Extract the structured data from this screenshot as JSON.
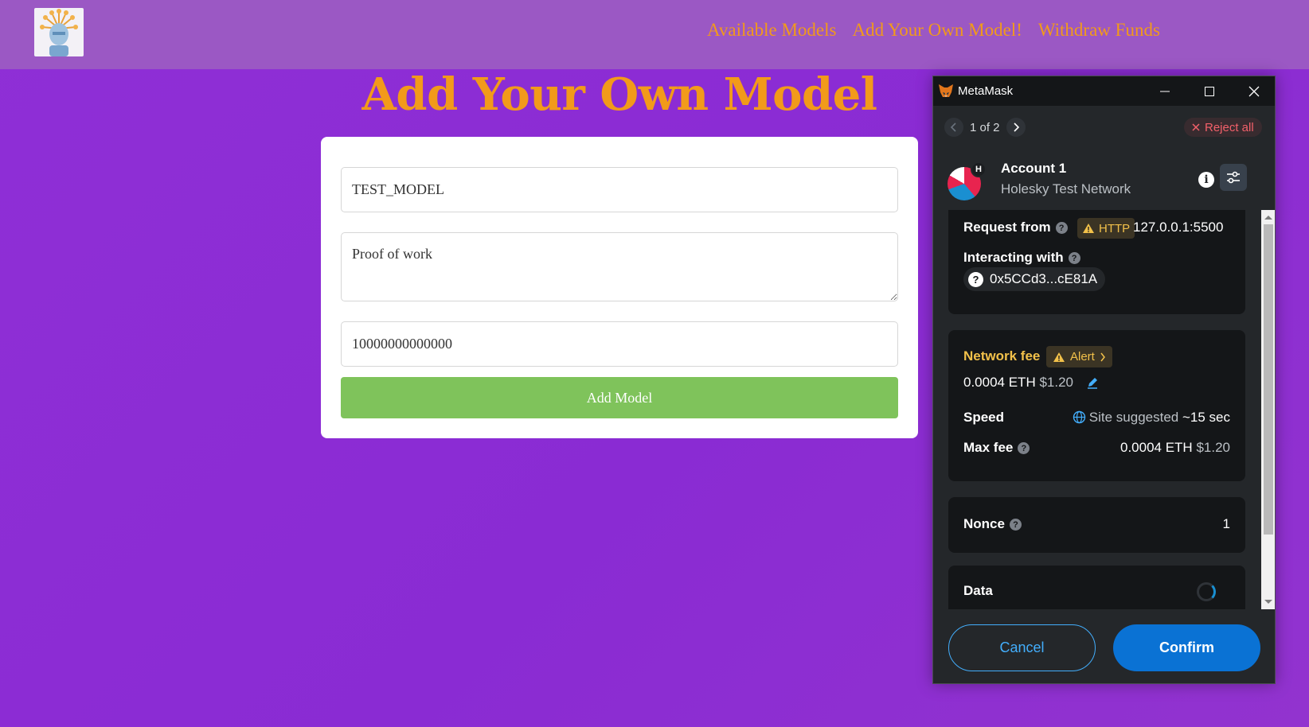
{
  "site": {
    "nav": {
      "available_models": "Available Models",
      "add_model": "Add Your Own Model!",
      "withdraw": "Withdraw Funds"
    },
    "page_title": "Add Your Own Model",
    "form": {
      "model_name": "TEST_MODEL",
      "description": "Proof of work",
      "price": "10000000000000",
      "submit_label": "Add Model"
    }
  },
  "metamask": {
    "window_title": "MetaMask",
    "pager": "1 of 2",
    "reject_all": "Reject all",
    "account_name": "Account 1",
    "account_badge": "H",
    "network": "Holesky Test Network",
    "request_from_label": "Request from",
    "http_badge": "HTTP",
    "request_origin": "127.0.0.1:5500",
    "interacting_with_label": "Interacting with",
    "contract_address": "0x5CCd3...cE81A",
    "network_fee_label": "Network fee",
    "alert_label": "Alert",
    "fee_eth": "0.0004 ETH",
    "fee_usd": "$1.20",
    "speed_label": "Speed",
    "speed_value": "Site suggested",
    "speed_time": "~15 sec",
    "max_fee_label": "Max fee",
    "max_fee_eth": "0.0004 ETH",
    "max_fee_usd": "$1.20",
    "nonce_label": "Nonce",
    "nonce_value": "1",
    "data_label": "Data",
    "cancel_label": "Cancel",
    "confirm_label": "Confirm"
  },
  "colors": {
    "page_bg": "#8a2bd3",
    "header_bg": "#9b58c4",
    "accent_orange": "#f29a1a",
    "add_button": "#7fc35b",
    "mm_confirm": "#0a72d4",
    "mm_link_blue": "#43aefc",
    "mm_warning": "#f2c14a",
    "mm_danger": "#f2606a"
  }
}
